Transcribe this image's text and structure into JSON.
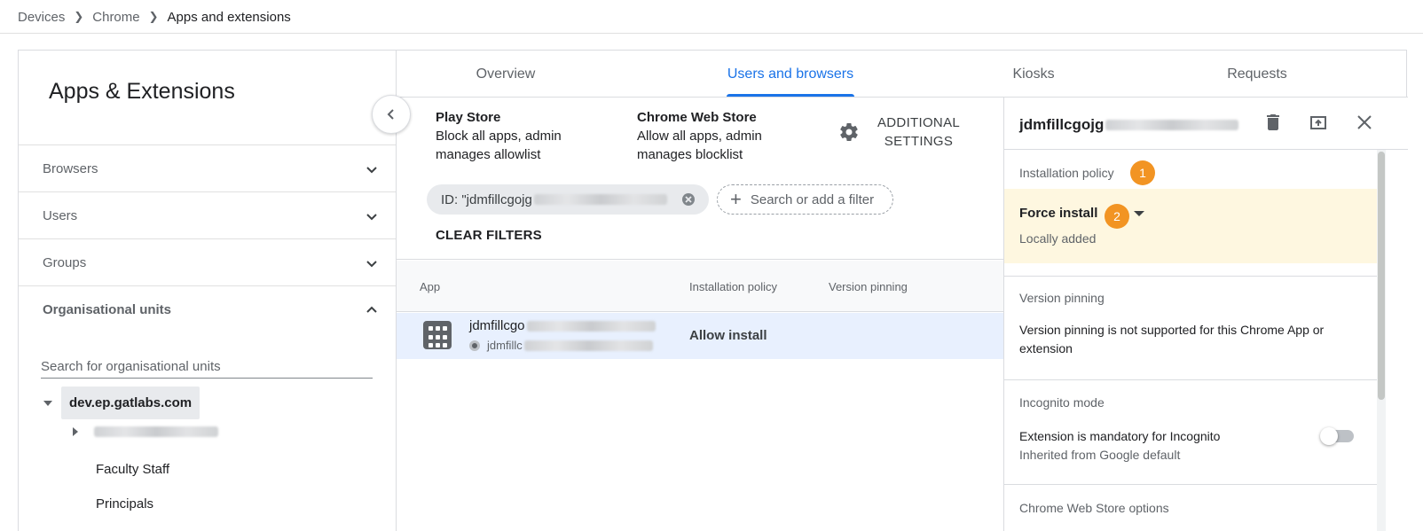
{
  "breadcrumb": {
    "items": [
      "Devices",
      "Chrome",
      "Apps and extensions"
    ]
  },
  "left_panel": {
    "title": "Apps & Extensions",
    "sections": {
      "browsers": "Browsers",
      "users": "Users",
      "groups": "Groups",
      "org_units": "Organisational units"
    },
    "org_search_placeholder": "Search for organisational units",
    "tree": {
      "root": "dev.ep.gatlabs.com",
      "leaves": [
        "Faculty Staff",
        "Principals"
      ]
    }
  },
  "tabs": [
    "Overview",
    "Users and browsers",
    "Kiosks",
    "Requests"
  ],
  "settings": {
    "play_store": {
      "title": "Play Store",
      "line1": "Block all apps, admin",
      "line2": "manages allowlist"
    },
    "web_store": {
      "title": "Chrome Web Store",
      "line1": "Allow all apps, admin",
      "line2": "manages blocklist"
    },
    "additional_line1": "ADDITIONAL",
    "additional_line2": "SETTINGS"
  },
  "filters": {
    "chip_text": "ID: \"jdmfillcgojg",
    "add_placeholder": "Search or add a filter",
    "clear_label": "CLEAR FILTERS"
  },
  "table": {
    "headers": {
      "app": "App",
      "policy": "Installation policy",
      "pinning": "Version pinning"
    },
    "rows": [
      {
        "name": "jdmfillcgo",
        "sub": "jdmfillc",
        "policy": "Allow install"
      }
    ]
  },
  "detail": {
    "title": "jdmfillcgojg",
    "installation_policy_label": "Installation policy",
    "badge1": "1",
    "badge2": "2",
    "force_install": "Force install",
    "locally_added": "Locally added",
    "version_pinning_label": "Version pinning",
    "version_pinning_text": "Version pinning is not supported for this Chrome App or extension",
    "incognito_label": "Incognito mode",
    "incognito_text": "Extension is mandatory for Incognito",
    "incognito_sub": "Inherited from Google default",
    "cws_label": "Chrome Web Store options"
  },
  "colors": {
    "accent": "#1a73e8",
    "badge": "#f29423",
    "highlight": "#fef7e0",
    "row_selected": "#e8f0fe"
  },
  "icons": {
    "chevron_down": "chevron-down-icon",
    "chevron_up": "chevron-up-icon",
    "chevron_left": "chevron-left-icon",
    "gear": "gear-icon",
    "delete": "delete-icon",
    "open_in_new": "open-in-new-icon",
    "close": "close-icon",
    "app_grid": "app-grid-icon",
    "chrome": "chrome-icon"
  }
}
